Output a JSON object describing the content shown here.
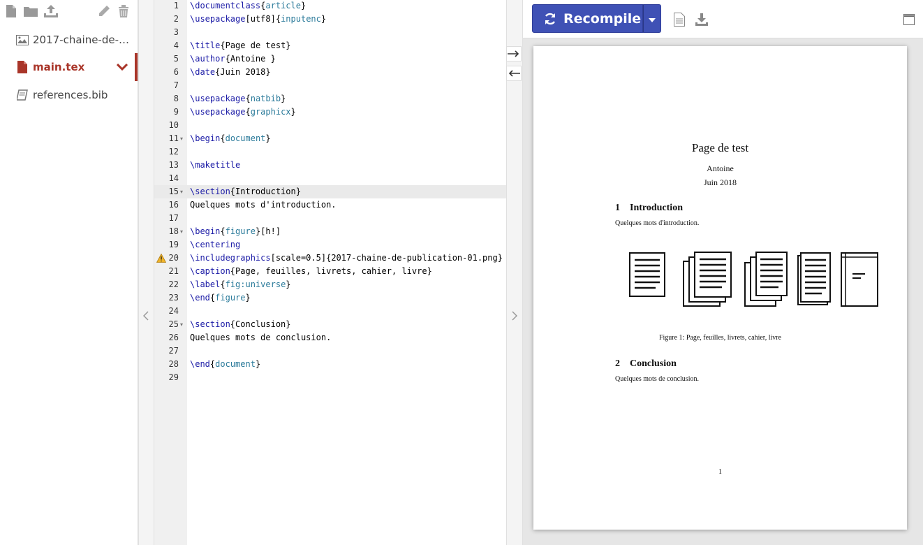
{
  "files": [
    {
      "name": "2017-chaine-de-pu...",
      "icon": "image-file-icon",
      "active": false
    },
    {
      "name": "main.tex",
      "icon": "tex-file-icon",
      "active": true
    },
    {
      "name": "references.bib",
      "icon": "book-icon",
      "active": false
    }
  ],
  "editor": {
    "active_line": 15,
    "warning_line": 20,
    "lines": [
      "\\documentclass{article}",
      "\\usepackage[utf8]{inputenc}",
      "",
      "\\title{Page de test}",
      "\\author{Antoine }",
      "\\date{Juin 2018}",
      "",
      "\\usepackage{natbib}",
      "\\usepackage{graphicx}",
      "",
      "\\begin{document}",
      "",
      "\\maketitle",
      "",
      "\\section{Introduction}",
      "Quelques mots d'introduction.",
      "",
      "\\begin{figure}[h!]",
      "\\centering",
      "\\includegraphics[scale=0.5]{2017-chaine-de-publication-01.png}",
      "\\caption{Page, feuilles, livrets, cahier, livre}",
      "\\label{fig:universe}",
      "\\end{figure}",
      "",
      "\\section{Conclusion}",
      "Quelques mots de conclusion.",
      "",
      "\\end{document}",
      ""
    ],
    "fold_lines": [
      11,
      15,
      18,
      25
    ]
  },
  "toolbar": {
    "recompile_label": "Recompile"
  },
  "pdf": {
    "title": "Page de test",
    "author": "Antoine",
    "date": "Juin 2018",
    "sections": [
      {
        "number": "1",
        "title": "Introduction",
        "body": "Quelques mots d'introduction."
      },
      {
        "number": "2",
        "title": "Conclusion",
        "body": "Quelques mots de conclusion."
      }
    ],
    "figure_caption": "Figure 1: Page, feuilles, livrets, cahier, livre",
    "page_number": "1"
  },
  "colors": {
    "accent": "#3f51b5",
    "active_file": "#a93529",
    "keyword": "#1a1aa6",
    "argument": "#2a7a9a"
  }
}
